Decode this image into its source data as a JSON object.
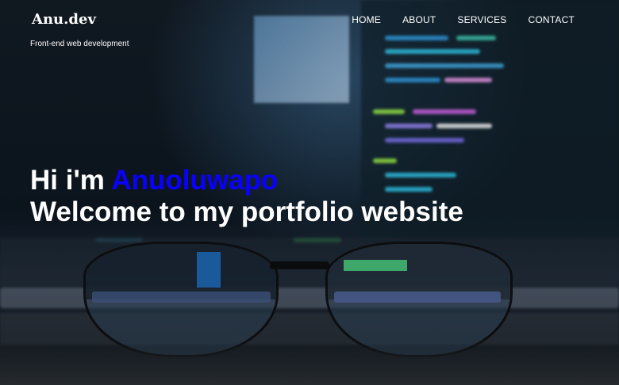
{
  "brand": {
    "logo": "Anu.dev",
    "tagline": "Front-end web development"
  },
  "nav": {
    "items": [
      "HOME",
      "ABOUT",
      "SERVICES",
      "CONTACT"
    ]
  },
  "hero": {
    "greeting": "Hi i'm",
    "name": "Anuoluwapo",
    "welcome": "Welcome to my portfolio website"
  },
  "colors": {
    "accent": "#0a00ff",
    "text": "#ffffff"
  }
}
